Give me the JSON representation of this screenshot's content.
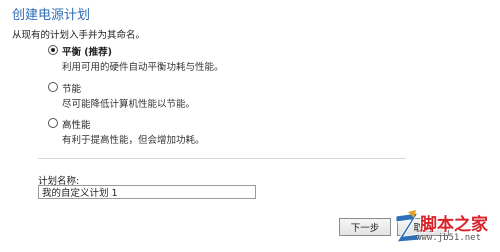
{
  "title": "创建电源计划",
  "instruction": "从现有的计划入手并为其命名。",
  "options": [
    {
      "label": "平衡 (推荐)",
      "description": "利用可用的硬件自动平衡功耗与性能。",
      "selected": true
    },
    {
      "label": "节能",
      "description": "尽可能降低计算机性能以节能。",
      "selected": false
    },
    {
      "label": "高性能",
      "description": "有利于提高性能，但会增加功耗。",
      "selected": false
    }
  ],
  "plan_name": {
    "label": "计划名称:",
    "value": "我的自定义计划 1"
  },
  "buttons": {
    "next": "下一步",
    "cancel": "取消"
  },
  "watermark": {
    "text": "脚本之家",
    "url": "www.jb51.net",
    "icon": "z-logo-icon"
  },
  "colors": {
    "title": "#2f6db5",
    "watermark": "#d8232a"
  }
}
